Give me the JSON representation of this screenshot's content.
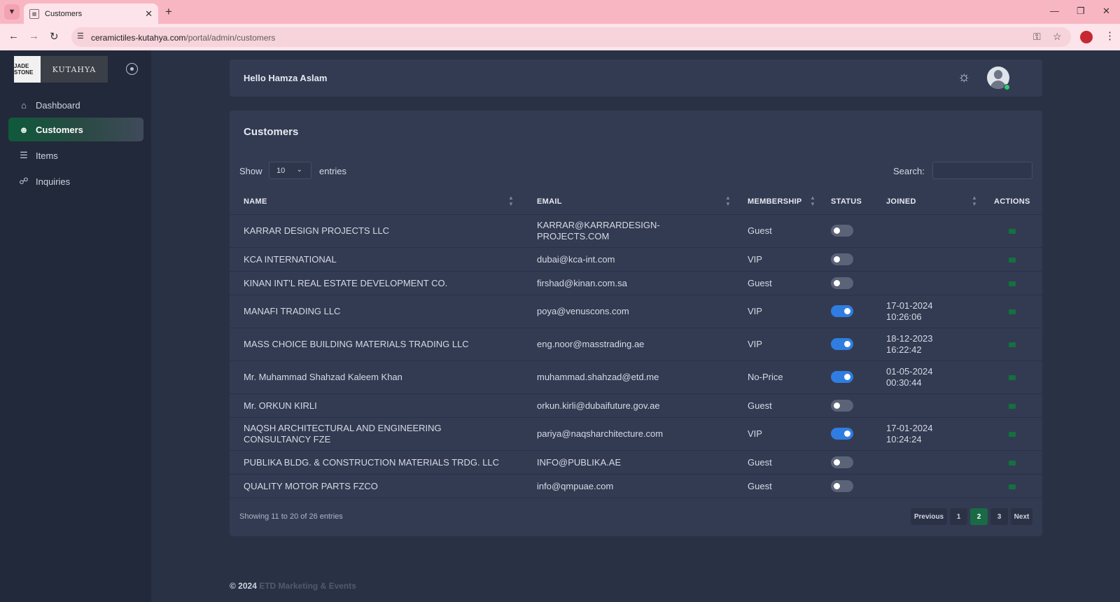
{
  "browser": {
    "tab_title": "Customers",
    "url_host": "ceramictiles-kutahya.com",
    "url_path": "/portal/admin/customers"
  },
  "sidebar": {
    "logo_left": "JADE STONE",
    "logo_right": "KUTAHYA",
    "items": [
      {
        "label": "Dashboard",
        "icon": "home-icon",
        "active": false
      },
      {
        "label": "Customers",
        "icon": "users-icon",
        "active": true
      },
      {
        "label": "Items",
        "icon": "stack-icon",
        "active": false
      },
      {
        "label": "Inquiries",
        "icon": "clipboard-search-icon",
        "active": false
      }
    ]
  },
  "header": {
    "greeting": "Hello Hamza Aslam"
  },
  "customers": {
    "title": "Customers",
    "show_label": "Show",
    "entries_value": "10",
    "entries_label": "entries",
    "search_label": "Search:",
    "search_value": "",
    "columns": [
      "NAME",
      "EMAIL",
      "MEMBERSHIP",
      "STATUS",
      "JOINED",
      "ACTIONS"
    ],
    "rows": [
      {
        "name": "KARRAR DESIGN PROJECTS LLC",
        "email": "KARRAR@KARRARDESIGN-PROJECTS.COM",
        "membership": "Guest",
        "active": false,
        "joined_date": "",
        "joined_time": ""
      },
      {
        "name": "KCA INTERNATIONAL",
        "email": "dubai@kca-int.com",
        "membership": "VIP",
        "active": false,
        "joined_date": "",
        "joined_time": ""
      },
      {
        "name": "KINAN INT'L REAL ESTATE DEVELOPMENT CO.",
        "email": "firshad@kinan.com.sa",
        "membership": "Guest",
        "active": false,
        "joined_date": "",
        "joined_time": ""
      },
      {
        "name": "MANAFI TRADING LLC",
        "email": "poya@venuscons.com",
        "membership": "VIP",
        "active": true,
        "joined_date": "17-01-2024",
        "joined_time": "10:26:06"
      },
      {
        "name": "MASS CHOICE BUILDING MATERIALS TRADING LLC",
        "email": "eng.noor@masstrading.ae",
        "membership": "VIP",
        "active": true,
        "joined_date": "18-12-2023",
        "joined_time": "16:22:42"
      },
      {
        "name": "Mr. Muhammad Shahzad Kaleem Khan",
        "email": "muhammad.shahzad@etd.me",
        "membership": "No-Price",
        "active": true,
        "joined_date": "01-05-2024",
        "joined_time": "00:30:44"
      },
      {
        "name": "Mr. ORKUN KIRLI",
        "email": "orkun.kirli@dubaifuture.gov.ae",
        "membership": "Guest",
        "active": false,
        "joined_date": "",
        "joined_time": ""
      },
      {
        "name": "NAQSH ARCHITECTURAL AND ENGINEERING CONSULTANCY FZE",
        "email": "pariya@naqsharchitecture.com",
        "membership": "VIP",
        "active": true,
        "joined_date": "17-01-2024",
        "joined_time": "10:24:24"
      },
      {
        "name": "PUBLIKA BLDG. & CONSTRUCTION MATERIALS TRDG. LLC",
        "email": "INFO@PUBLIKA.AE",
        "membership": "Guest",
        "active": false,
        "joined_date": "",
        "joined_time": ""
      },
      {
        "name": "QUALITY MOTOR PARTS FZCO",
        "email": "info@qmpuae.com",
        "membership": "Guest",
        "active": false,
        "joined_date": "",
        "joined_time": ""
      }
    ],
    "info": "Showing 11 to 20 of 26 entries",
    "pagination": {
      "previous": "Previous",
      "pages": [
        "1",
        "2",
        "3"
      ],
      "current": "2",
      "next": "Next"
    }
  },
  "footer": {
    "copyright": "© 2024",
    "brand": "ETD Marketing & Events"
  },
  "colors": {
    "page_bg": "#293145",
    "card_bg": "#333b52",
    "accent_green": "#1a6a45",
    "toggle_on": "#2f7de1"
  }
}
